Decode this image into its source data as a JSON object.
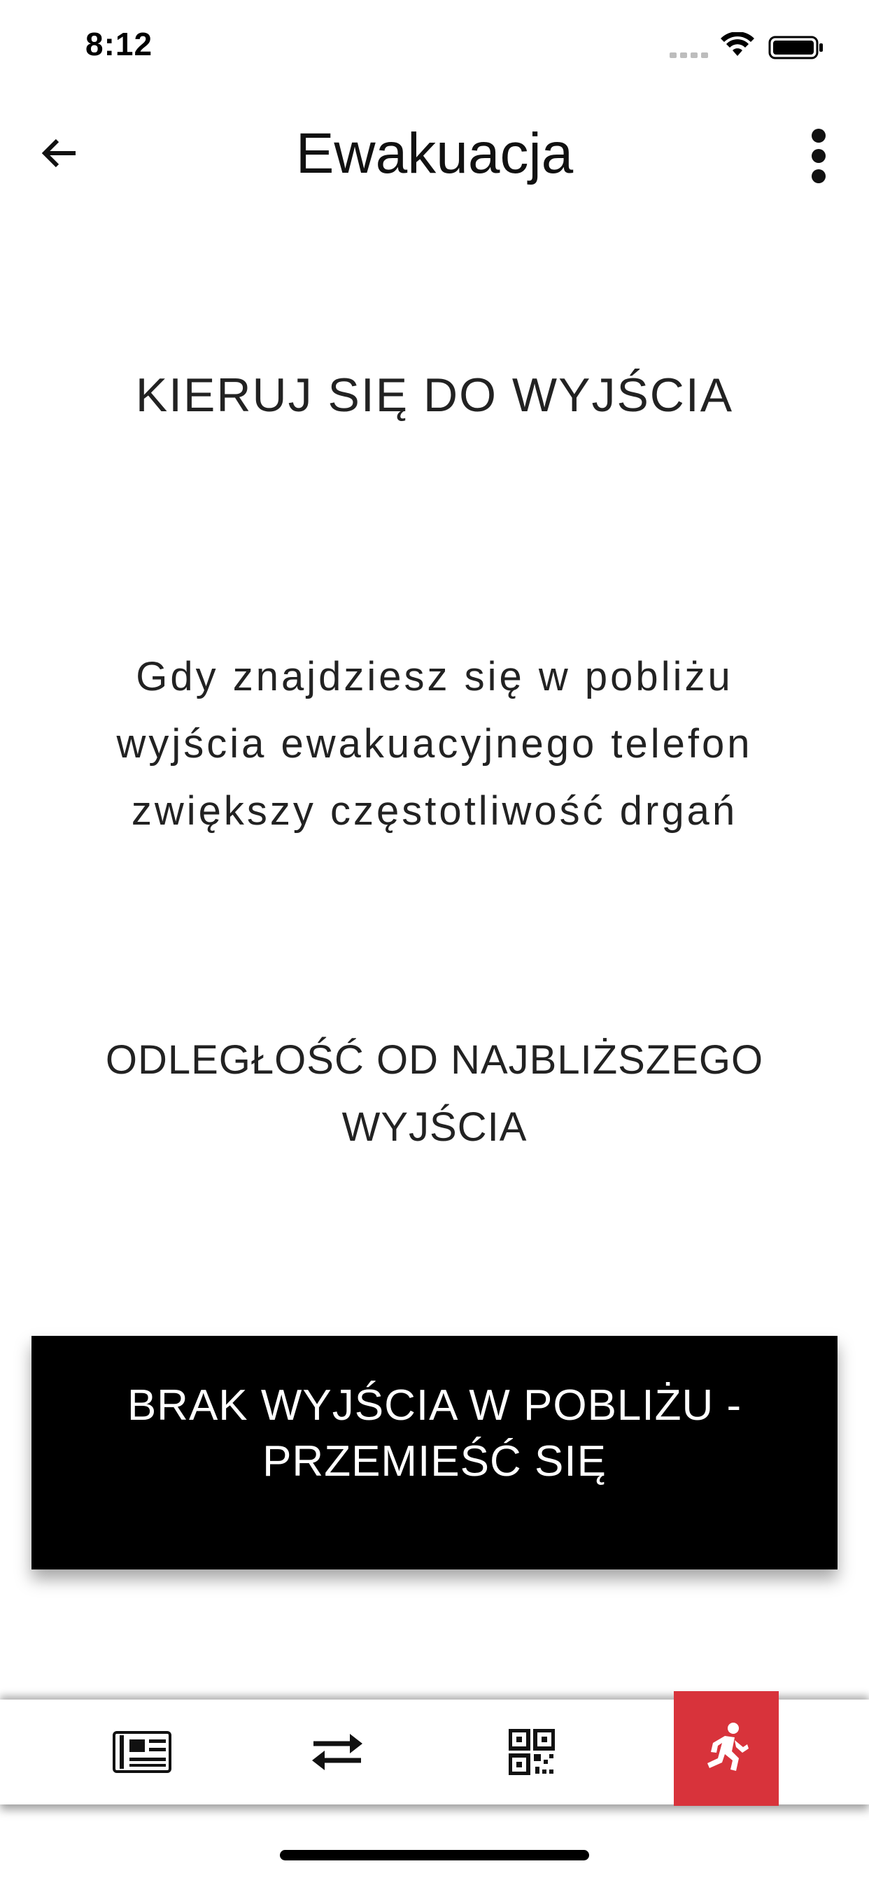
{
  "status_bar": {
    "time": "8:12",
    "icons": [
      "cellular-signal-icon",
      "wifi-icon",
      "battery-icon"
    ]
  },
  "app_bar": {
    "title": "Ewakuacja",
    "back_icon": "arrow-left-icon",
    "menu_icon": "more-vertical-icon"
  },
  "content": {
    "heading": "KIERUJ SIĘ DO WYJŚCIA",
    "info_lines": [
      "Gdy znajdziesz się w pobliżu",
      "wyjścia ewakuacyjnego telefon",
      "zwiększy częstotliwość drgań"
    ],
    "distance_lines": [
      "ODLEGŁOŚĆ OD NAJBLIŻSZEGO",
      "WYJŚCIA"
    ],
    "status_lines": [
      "BRAK WYJŚCIA W POBLIŻU -",
      "PRZEMIEŚĆ SIĘ"
    ]
  },
  "bottom_nav": {
    "items": [
      {
        "icon": "newspaper-icon",
        "active": false
      },
      {
        "icon": "swap-arrows-icon",
        "active": false
      },
      {
        "icon": "qr-code-icon",
        "active": false
      },
      {
        "icon": "running-person-icon",
        "active": true
      }
    ],
    "active_color": "#d8333b"
  },
  "colors": {
    "panel_background": "#000000",
    "panel_text": "#ffffff",
    "accent": "#d8333b"
  }
}
